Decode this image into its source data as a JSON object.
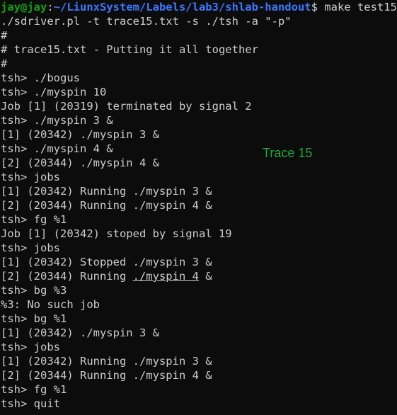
{
  "prompt": {
    "user": "jay@jay",
    "separator": ":",
    "path": "~/LiunxSystem/Labels/lab3/shlab-handout",
    "symbol": "$",
    "command": " make test15"
  },
  "lines": [
    "./sdriver.pl -t trace15.txt -s ./tsh -a \"-p\"",
    "#",
    "# trace15.txt - Putting it all together",
    "#",
    "tsh> ./bogus",
    "tsh> ./myspin 10",
    "Job [1] (20319) terminated by signal 2",
    "tsh> ./myspin 3 &",
    "[1] (20342) ./myspin 3 &",
    "tsh> ./myspin 4 &",
    "[2] (20344) ./myspin 4 &",
    "tsh> jobs",
    "[1] (20342) Running ./myspin 3 &",
    "[2] (20344) Running ./myspin 4 &",
    "tsh> fg %1",
    "Job [1] (20342) stoped by signal 19",
    "tsh> jobs",
    "[1] (20342) Stopped ./myspin 3 &"
  ],
  "underlined_line": {
    "before": "[2] (20344) Running ",
    "underlined": "./myspin 4",
    "after": " &"
  },
  "lines_after": [
    "tsh> bg %3",
    "%3: No such job",
    "tsh> bg %1",
    "[1] (20342) ./myspin 3 &",
    "tsh> jobs",
    "[1] (20342) Running ./myspin 3 &",
    "[2] (20344) Running ./myspin 4 &",
    "tsh> fg %1",
    "tsh> quit"
  ],
  "annotation": "Trace 15",
  "colors": {
    "background": "#0c0c0c",
    "text": "#cccccc",
    "prompt_user": "#13a10e",
    "prompt_path": "#3b78ff",
    "annotation": "#22a83a"
  }
}
